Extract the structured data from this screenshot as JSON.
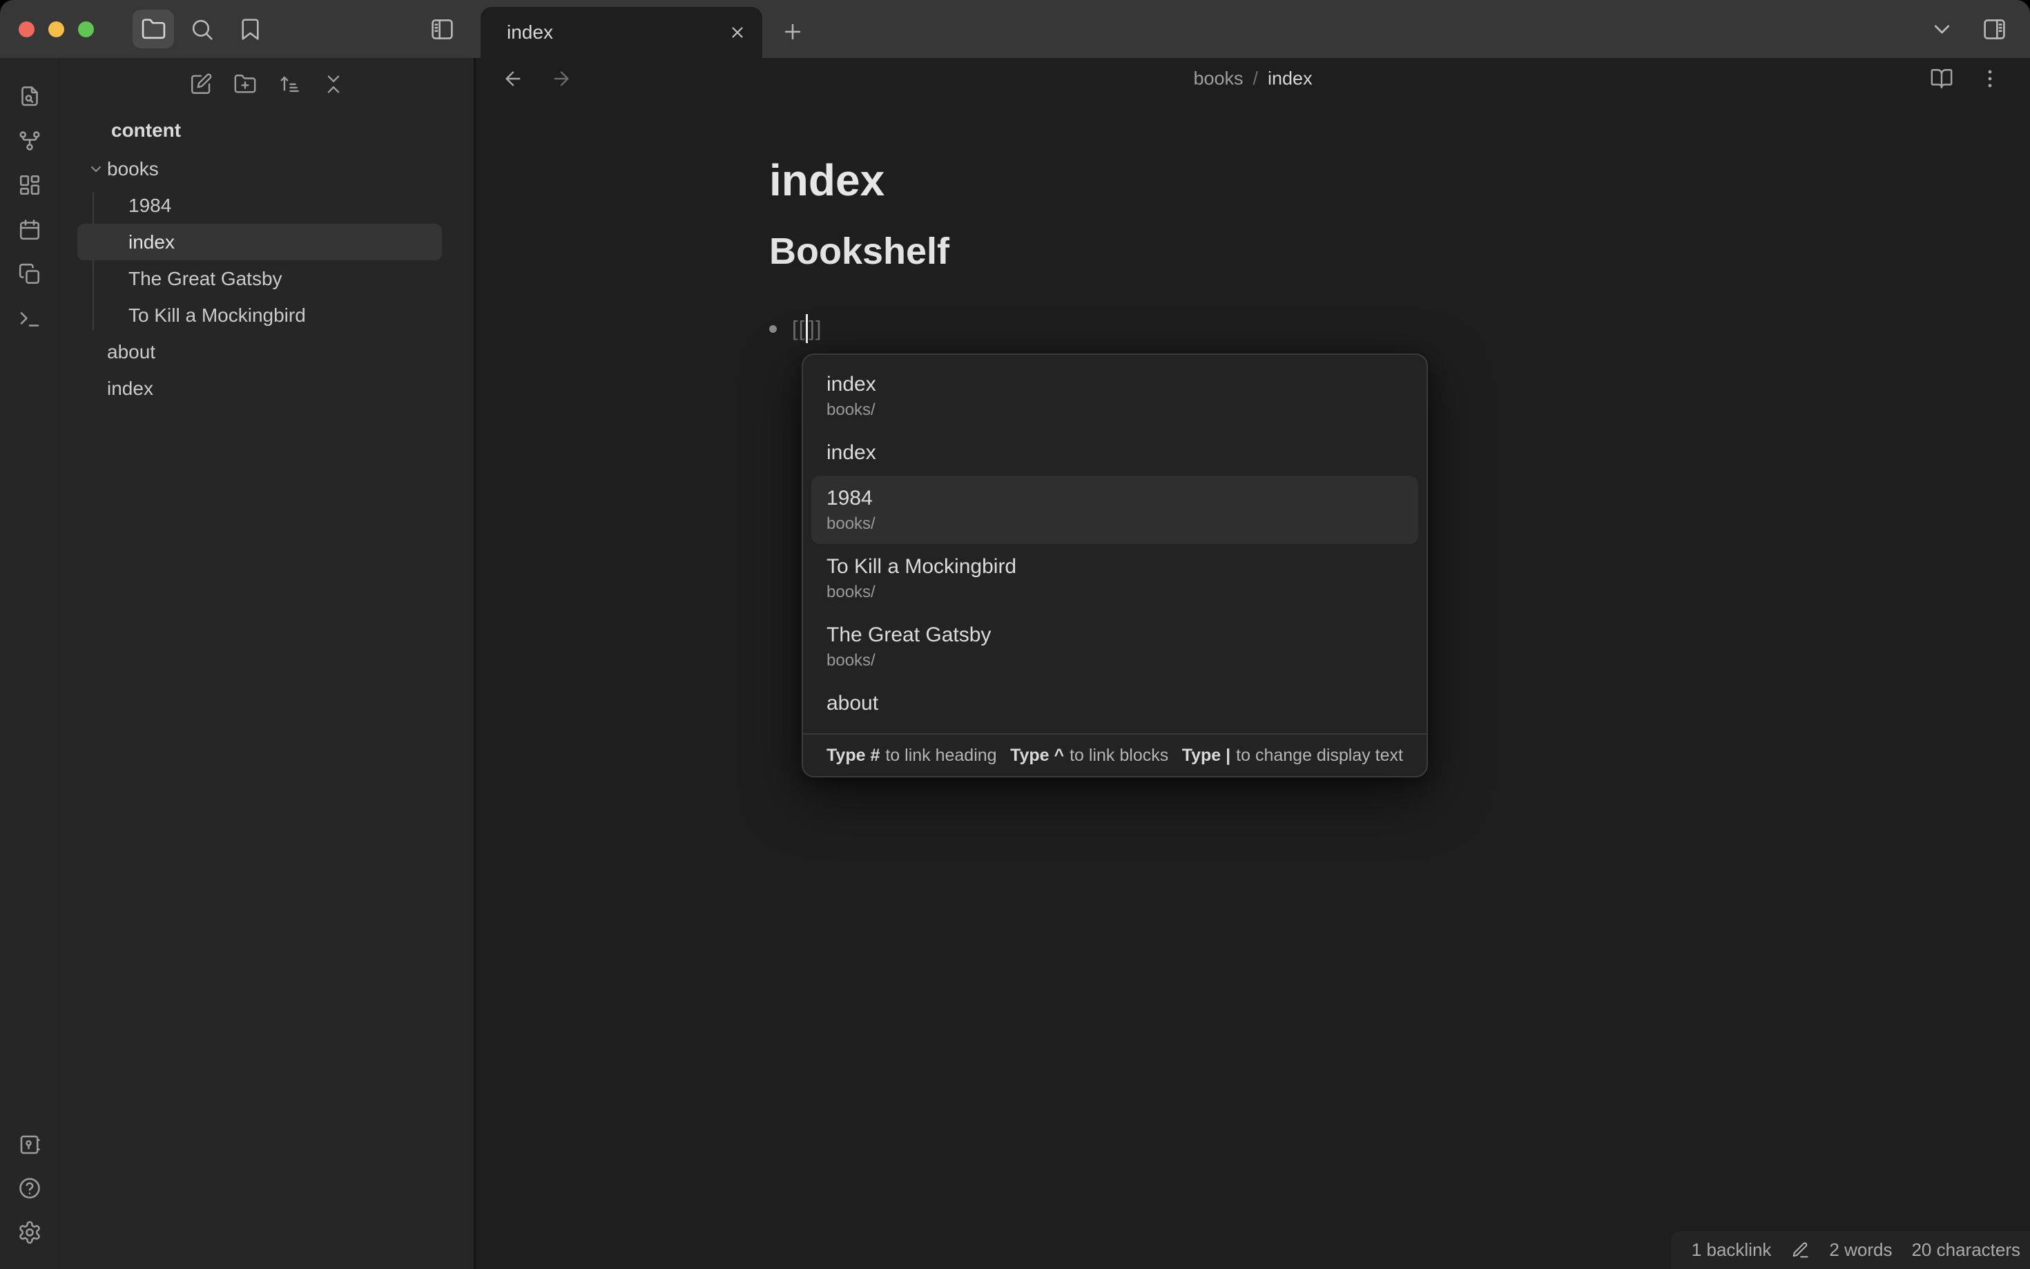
{
  "colors": {
    "titlebar_bg": "#373737",
    "sidebar_bg": "#262626",
    "editor_bg": "#1e1e1e",
    "popup_bg": "#232323",
    "selection_bg": "#353535",
    "traffic_red": "#ee6a5f",
    "traffic_yellow": "#f5bd4c",
    "traffic_green": "#62c454"
  },
  "titlebar": {
    "toolbar": [
      {
        "icon": "folder-icon",
        "active": true
      },
      {
        "icon": "search-icon"
      },
      {
        "icon": "bookmark-icon"
      },
      {
        "icon": "panel-left-icon"
      }
    ]
  },
  "tabbar": {
    "active_tab": "index",
    "close_label": "close-tab",
    "new_tab_label": "new-tab"
  },
  "ribbon": {
    "top": [
      "file-search",
      "graph",
      "canvas-dashboard",
      "calendar",
      "copy-templates",
      "terminal"
    ],
    "bottom": [
      "vault-switcher",
      "help",
      "settings"
    ]
  },
  "explorer": {
    "toolbar": [
      "new-note",
      "new-folder",
      "sort-order",
      "collapse-all"
    ],
    "vault_name": "content",
    "tree": [
      {
        "label": "books",
        "level": 0,
        "expanded": true
      },
      {
        "label": "1984",
        "level": 1
      },
      {
        "label": "index",
        "level": 1,
        "selected": true
      },
      {
        "label": "The Great Gatsby",
        "level": 1
      },
      {
        "label": "To Kill a Mockingbird",
        "level": 1
      },
      {
        "label": "about",
        "level": 0
      },
      {
        "label": "index",
        "level": 0
      }
    ]
  },
  "editor": {
    "breadcrumb": {
      "parent": "books",
      "separator": "/",
      "current": "index"
    },
    "title": "index",
    "heading": "Bookshelf",
    "link_open": "[[",
    "link_close": "]]"
  },
  "popup": {
    "items": [
      {
        "label": "index",
        "path": "books/"
      },
      {
        "label": "index"
      },
      {
        "label": "1984",
        "path": "books/",
        "selected": true
      },
      {
        "label": "To Kill a Mockingbird",
        "path": "books/"
      },
      {
        "label": "The Great Gatsby",
        "path": "books/"
      },
      {
        "label": "about"
      }
    ],
    "hints": [
      {
        "key": "Type #",
        "text": "to link heading"
      },
      {
        "key": "Type ^",
        "text": "to link blocks"
      },
      {
        "key": "Type |",
        "text": "to change display text"
      }
    ]
  },
  "statusbar": {
    "backlinks": "1 backlink",
    "words": "2 words",
    "characters": "20 characters"
  }
}
